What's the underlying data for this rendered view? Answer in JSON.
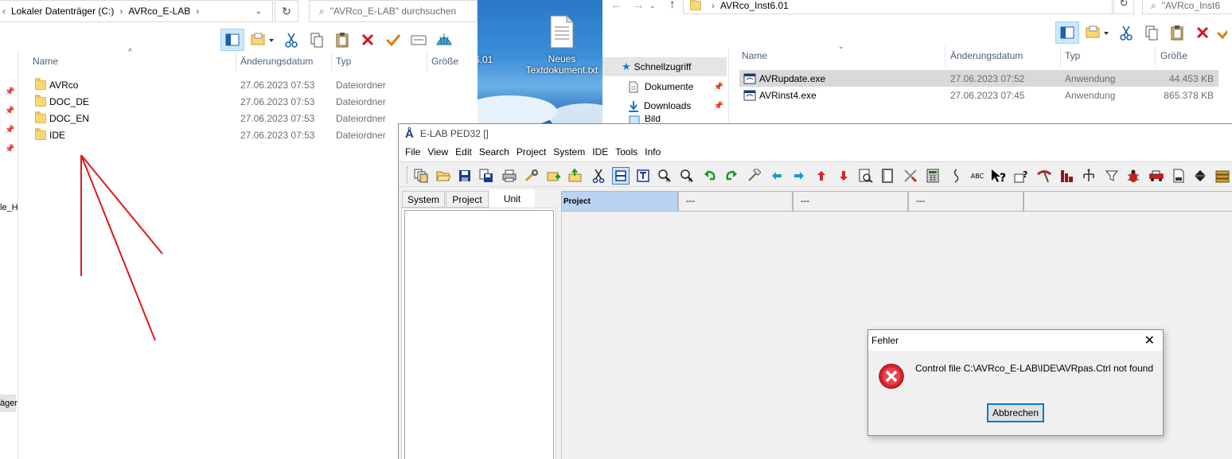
{
  "left_explorer": {
    "breadcrumb": [
      "Lokaler Datenträger (C:)",
      "AVRco_E-LAB"
    ],
    "search_placeholder": "\"AVRco_E-LAB\" durchsuchen",
    "columns": [
      "Name",
      "Änderungsdatum",
      "Typ",
      "Größe"
    ],
    "rows": [
      {
        "name": "AVRco",
        "date": "27.06.2023 07:53",
        "type": "Dateiordner"
      },
      {
        "name": "DOC_DE",
        "date": "27.06.2023 07:53",
        "type": "Dateiordner"
      },
      {
        "name": "DOC_EN",
        "date": "27.06.2023 07:53",
        "type": "Dateiordner"
      },
      {
        "name": "IDE",
        "date": "27.06.2023 07:53",
        "type": "Dateiordner"
      }
    ],
    "nav_fragment_1": "le_H",
    "nav_fragment_2": "äger"
  },
  "desktop": {
    "fragment_label": "6.01",
    "icon_label": "Neues Textdokument.txt"
  },
  "right_explorer": {
    "breadcrumb": [
      "AVRco_Inst6.01"
    ],
    "search_placeholder": "\"AVRco_Inst6",
    "nav": [
      {
        "label": "Schnellzugriff",
        "icon": "star-icon"
      },
      {
        "label": "Dokumente",
        "icon": "document-icon"
      },
      {
        "label": "Downloads",
        "icon": "download-icon"
      },
      {
        "label": "Bild",
        "icon": "picture-icon"
      }
    ],
    "columns": [
      "Name",
      "Änderungsdatum",
      "Typ",
      "Größe"
    ],
    "rows": [
      {
        "name": "AVRupdate.exe",
        "date": "27.06.2023 07:52",
        "type": "Anwendung",
        "size": "44.453 KB"
      },
      {
        "name": "AVRinst4.exe",
        "date": "27.06.2023 07:45",
        "type": "Anwendung",
        "size": "865.378 KB"
      }
    ]
  },
  "elab": {
    "title": "E-LAB PED32 []",
    "menu": [
      "File",
      "View",
      "Edit",
      "Search",
      "Project",
      "System",
      "IDE",
      "Tools",
      "Info"
    ],
    "left_tabs": [
      "System",
      "Project",
      "Unit"
    ],
    "editor_tabs": [
      "Project",
      "---",
      "---",
      "---"
    ]
  },
  "dialog": {
    "title": "Fehler",
    "message": "Control file C:\\AVRco_E-LAB\\IDE\\AVRpas.Ctrl not found",
    "button": "Abbrechen",
    "icon": "error-icon"
  },
  "colors": {
    "accent": "#0078d7",
    "annotation": "#e0191b",
    "error": "#d9232b"
  }
}
